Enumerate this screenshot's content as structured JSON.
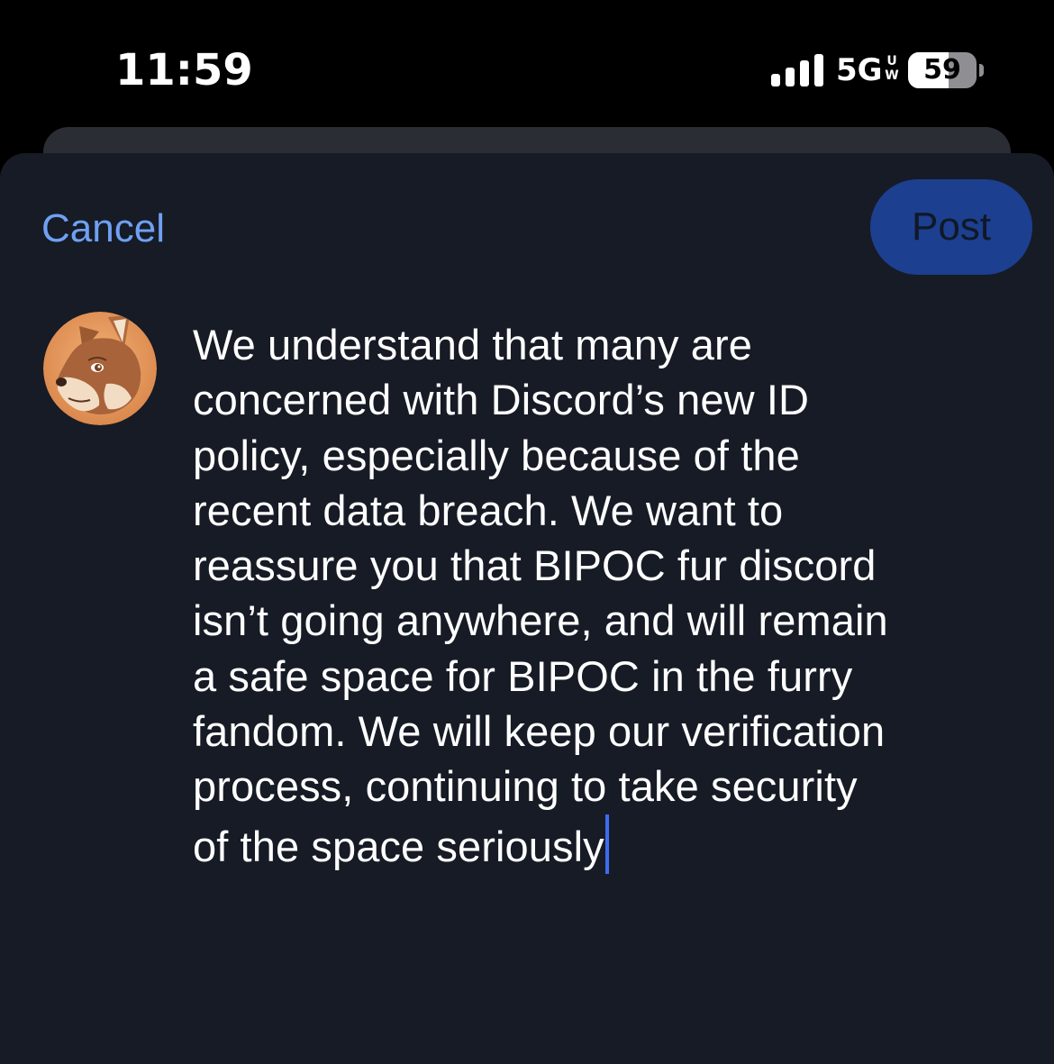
{
  "status_bar": {
    "time": "11:59",
    "network": "5G",
    "network_sub_top": "U",
    "network_sub_bottom": "W",
    "battery_level": "59",
    "battery_fraction": 0.59
  },
  "composer": {
    "cancel_label": "Cancel",
    "post_label": "Post",
    "text": "We understand that many are\nconcerned with Discord’s new ID\npolicy, especially because of the\nrecent data breach. We want to\nreassure you that BIPOC fur discord\nisn’t going anywhere, and will remain\na safe space for BIPOC in the furry\nfandom. We will keep our verification\nprocess, continuing to take security\nof the space seriously"
  },
  "colors": {
    "accent": "#6fa0f2",
    "post_button_bg": "#1c3f8f",
    "sheet_bg": "#161b25",
    "cursor": "#3d6cf0"
  },
  "icons": {
    "signal": "cellular-signal-icon",
    "battery": "battery-icon",
    "avatar": "fox-avatar"
  }
}
